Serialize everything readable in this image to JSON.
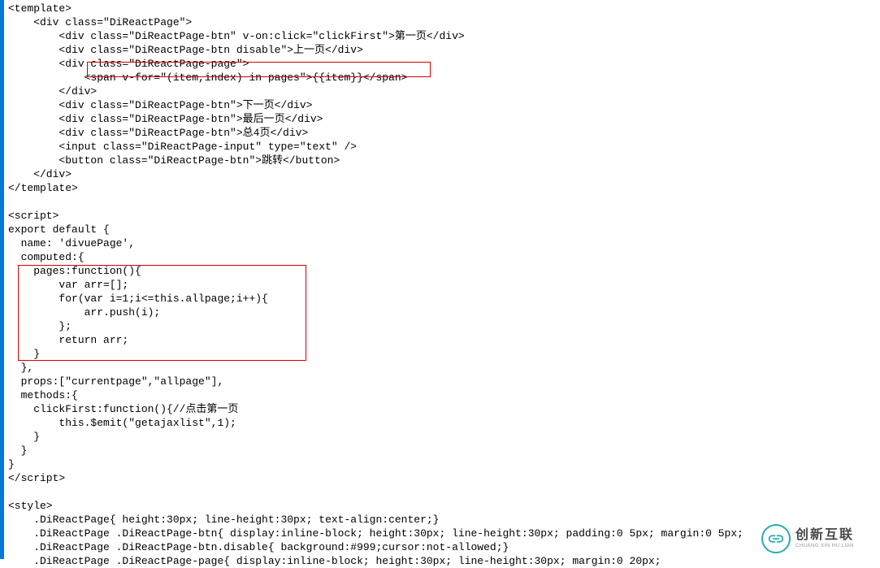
{
  "code": {
    "lines": [
      "<template>",
      "    <div class=\"DiReactPage\">",
      "        <div class=\"DiReactPage-btn\" v-on:click=\"clickFirst\">第一页</div>",
      "        <div class=\"DiReactPage-btn disable\">上一页</div>",
      "        <div class=\"DiReactPage-page\">",
      "            <span v-for=\"(item,index) in pages\">{{item}}</span>",
      "        </div>",
      "        <div class=\"DiReactPage-btn\">下一页</div>",
      "        <div class=\"DiReactPage-btn\">最后一页</div>",
      "        <div class=\"DiReactPage-btn\">总4页</div>",
      "        <input class=\"DiReactPage-input\" type=\"text\" />",
      "        <button class=\"DiReactPage-btn\">跳转</button>",
      "    </div>",
      "</template>",
      "",
      "<script>",
      "export default {",
      "  name: 'divuePage',",
      "  computed:{",
      "    pages:function(){",
      "        var arr=[];",
      "        for(var i=1;i<=this.allpage;i++){",
      "            arr.push(i);",
      "        };",
      "        return arr;",
      "    }",
      "  },",
      "  props:[\"currentpage\",\"allpage\"],",
      "  methods:{",
      "    clickFirst:function(){//点击第一页",
      "        this.$emit(\"getajaxlist\",1);",
      "    }",
      "  }",
      "}",
      "</script>",
      "",
      "<style>",
      "    .DiReactPage{ height:30px; line-height:30px; text-align:center;}",
      "    .DiReactPage .DiReactPage-btn{ display:inline-block; height:30px; line-height:30px; padding:0 5px; margin:0 5px;",
      "    .DiReactPage .DiReactPage-btn.disable{ background:#999;cursor:not-allowed;}",
      "    .DiReactPage .DiReactPage-page{ display:inline-block; height:30px; line-height:30px; margin:0 20px;"
    ]
  },
  "watermark": {
    "big": "创新互联",
    "small": "CHUANG XIN HU LIAN"
  }
}
